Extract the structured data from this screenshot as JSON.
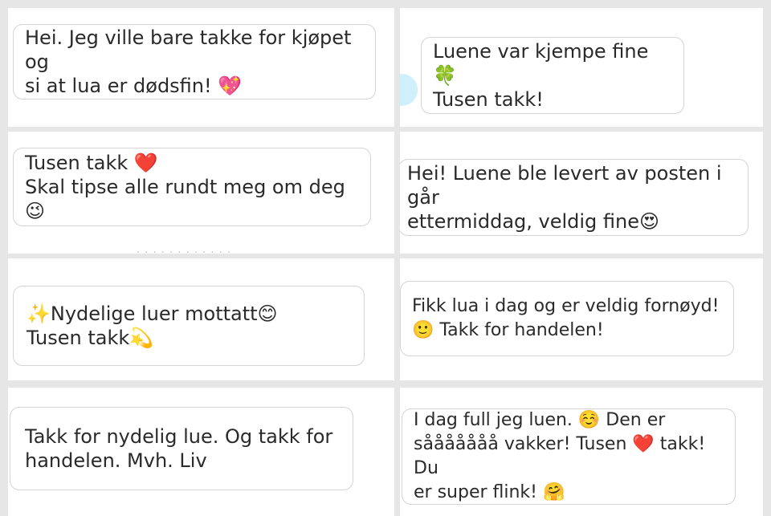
{
  "messages": [
    {
      "text": "Hei. Jeg ville bare takke for kjøpet og\nsi at lua er dødsfin! 💖"
    },
    {
      "text": "Luene var kjempe fine 🍀\nTusen takk!"
    },
    {
      "text": "Tusen takk ❤️\nSkal tipse alle rundt meg om deg 😉"
    },
    {
      "text": "Hei! Luene ble levert av posten i går\nettermiddag, veldig fine😍"
    },
    {
      "text": "✨Nydelige luer mottatt😊\nTusen takk💫"
    },
    {
      "text": "Fikk lua i dag og er veldig fornøyd!\n🙂 Takk for handelen!"
    },
    {
      "text": "Takk for nydelig lue. Og takk for\nhandelen. Mvh. Liv"
    },
    {
      "text": "I dag full jeg luen. ☺️ Den er\nsååååååå vakker! Tusen ❤️ takk! Du\ner super flink! 🤗"
    }
  ],
  "colors": {
    "background": "#e6e6e6",
    "panel": "#ffffff",
    "bubble_border": "#d4d4d4",
    "text": "#2a2a2a",
    "avatar": "#cfeffa"
  }
}
